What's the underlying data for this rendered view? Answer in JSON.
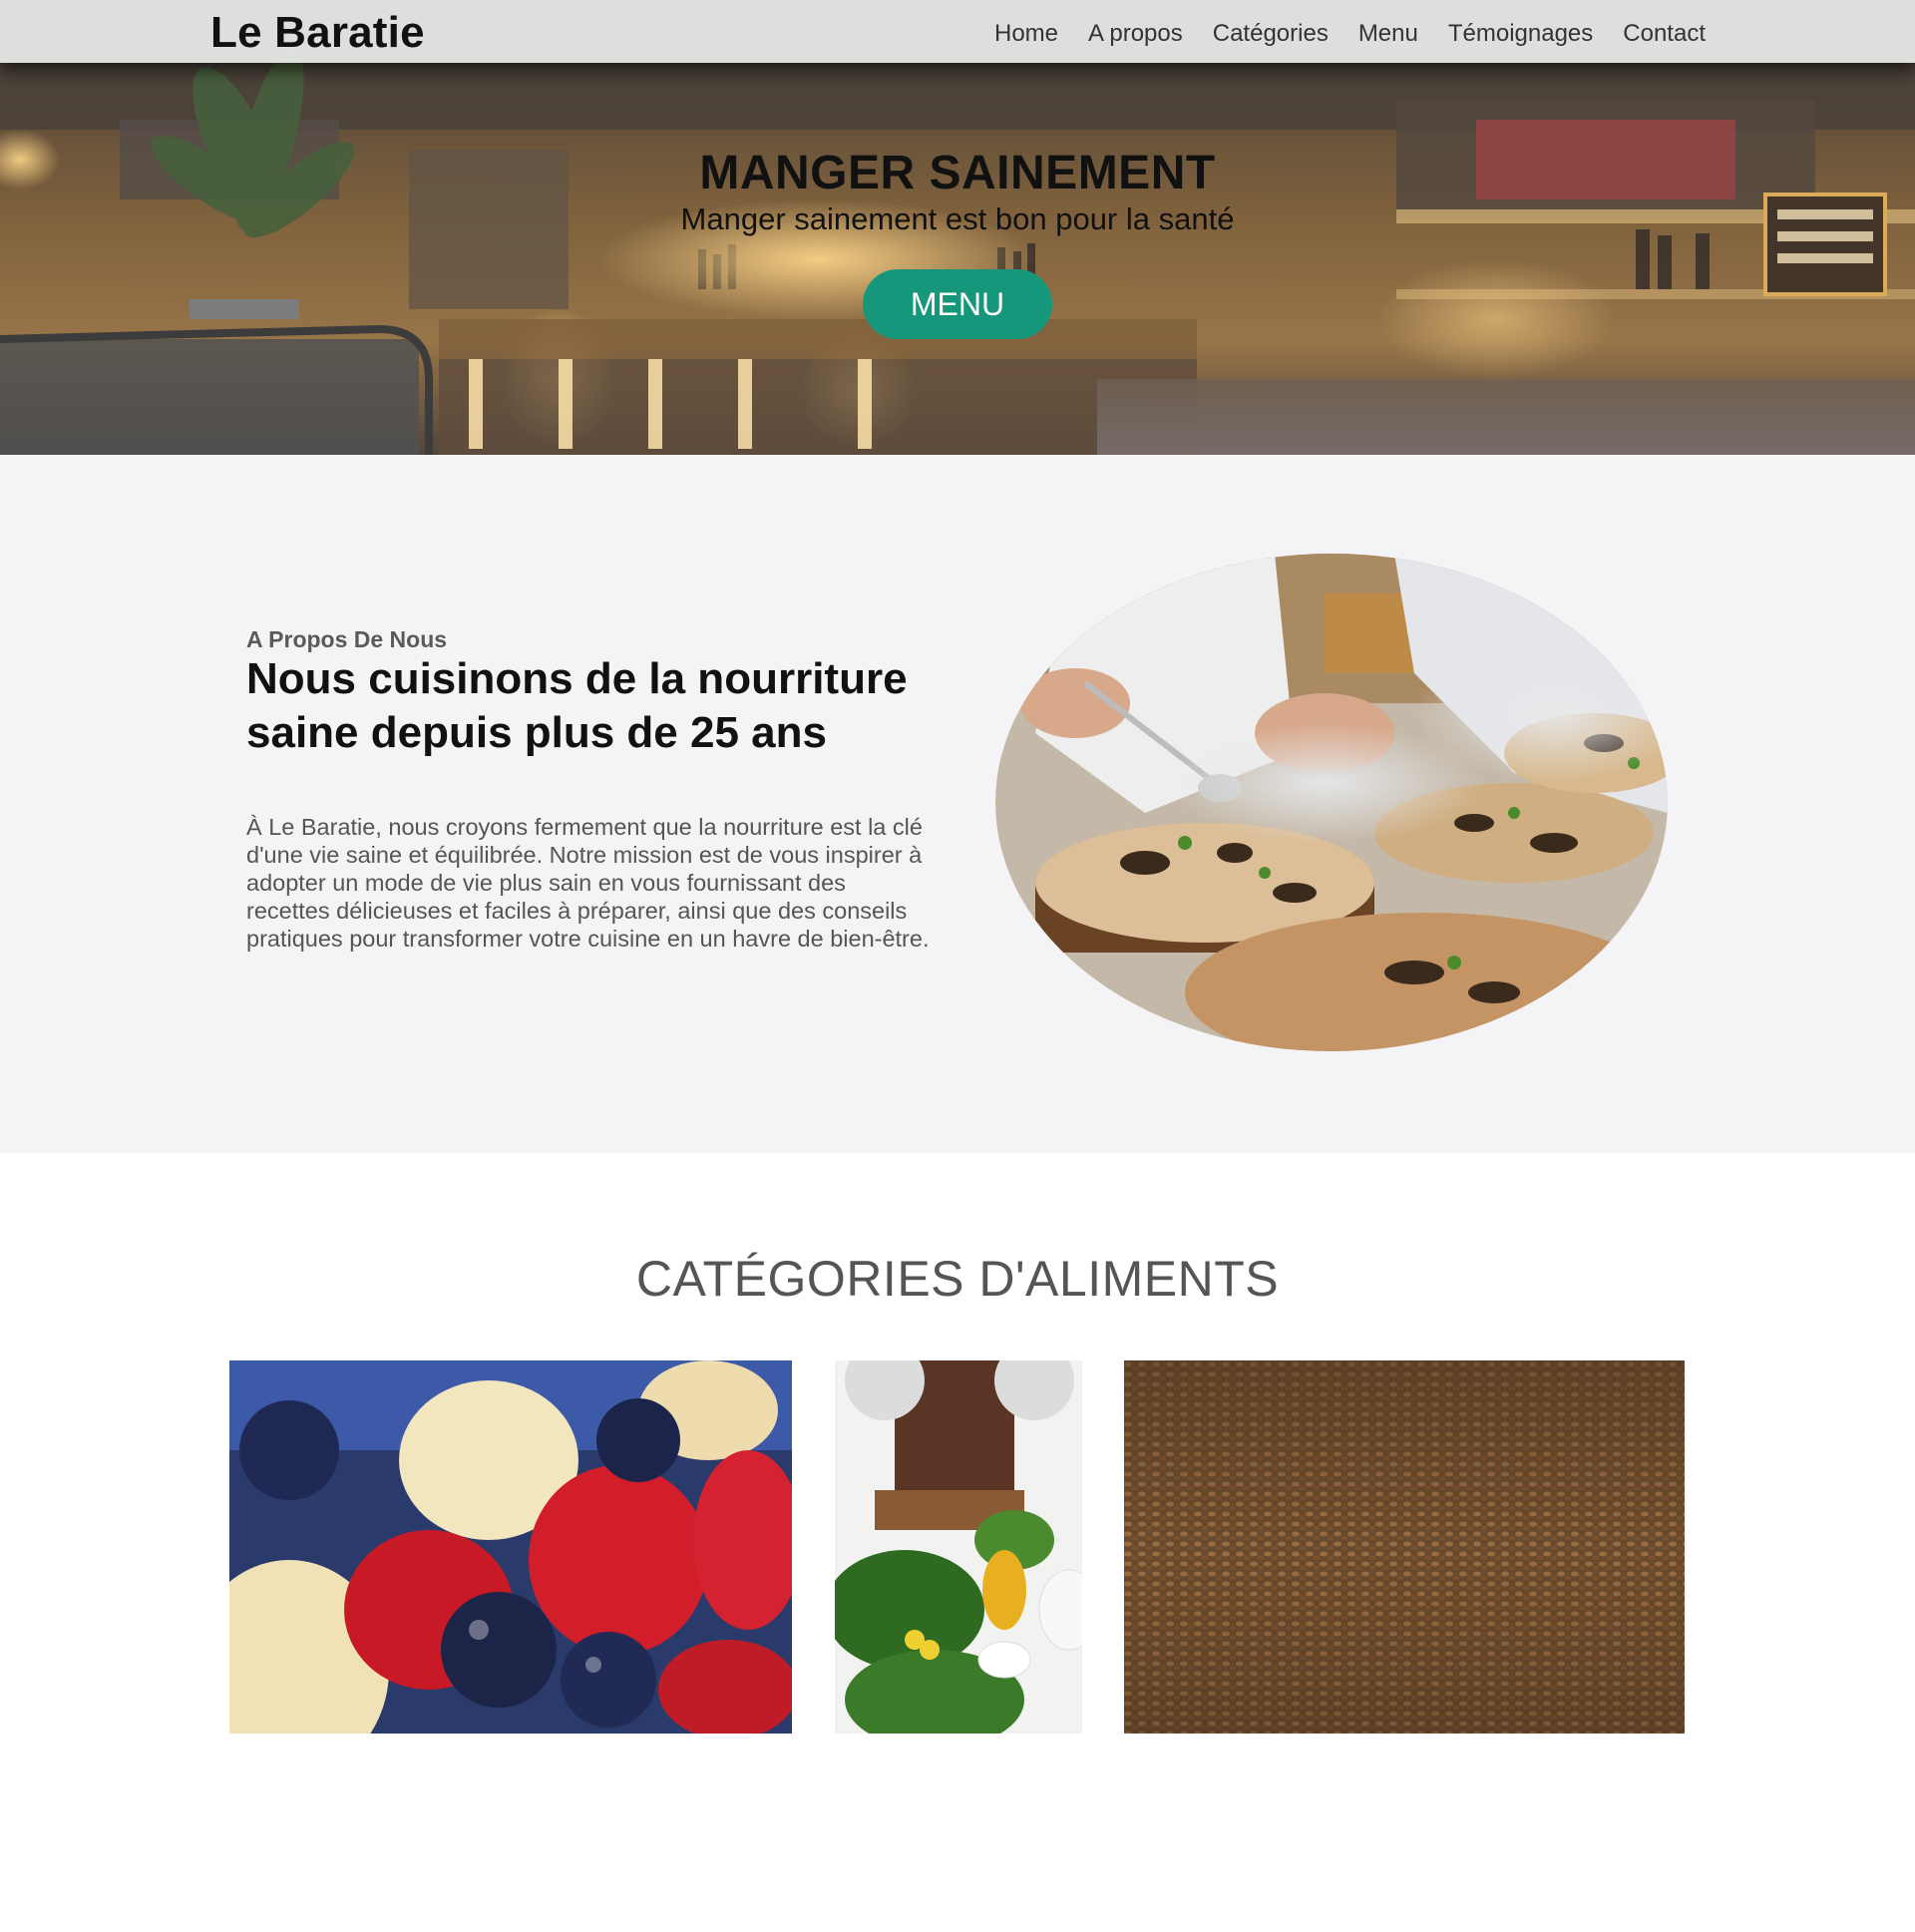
{
  "brand": {
    "name": "Le Baratie"
  },
  "nav": {
    "items": [
      {
        "label": "Home"
      },
      {
        "label": "A propos"
      },
      {
        "label": "Catégories"
      },
      {
        "label": "Menu"
      },
      {
        "label": "Témoignages"
      },
      {
        "label": "Contact"
      }
    ]
  },
  "hero": {
    "title": "MANGER SAINEMENT",
    "subtitle": "Manger sainement est bon pour la santé",
    "button_label": "MENU",
    "accent_color": "#16967a"
  },
  "about": {
    "kicker": "A Propos De Nous",
    "heading": "Nous cuisinons de la nourriture saine depuis plus de 25 ans",
    "text": "À Le Baratie, nous croyons fermement que la nourriture est la clé d'une vie saine et équilibrée. Notre mission est de vous inspirer à adopter un mode de vie plus sain en vous fournissant des recettes délicieuses et faciles à préparer, ainsi que des conseils pratiques pour transformer votre cuisine en un havre de bien-être."
  },
  "categories": {
    "title": "CATÉGORIES D'ALIMENTS"
  },
  "icons": {
    "hero_background": "restaurant-bar-photo",
    "about_image": "chef-plating-photo",
    "category_images": [
      "fruits-photo",
      "vegetables-photo",
      "grains-photo"
    ]
  }
}
